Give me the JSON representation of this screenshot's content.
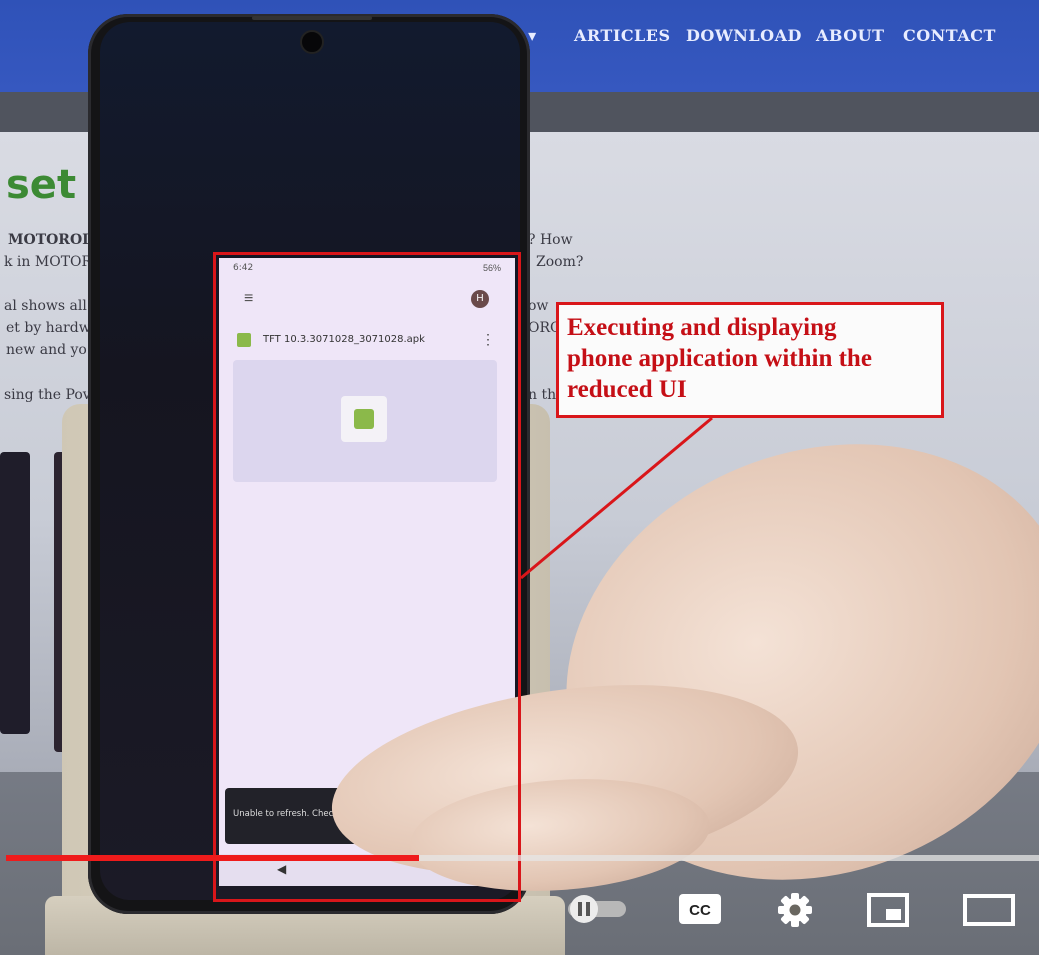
{
  "site": {
    "nav_items": [
      "S ▾",
      "ARTICLES",
      "DOWNLOAD",
      "ABOUT",
      "CONTACT"
    ],
    "heading": "set M",
    "lines": [
      {
        "text": "MOTOROLA",
        "bold": true
      },
      {
        "text": "k in MOTOR",
        "bold": false
      },
      {
        "text": "? How",
        "bold": false
      },
      {
        "text": "Zoom?",
        "bold": false
      },
      {
        "text": "al shows all",
        "bold": false
      },
      {
        "text": "et by hardw",
        "bold": false
      },
      {
        "text": "new and yo",
        "bold": false
      },
      {
        "text": "sing the Pov",
        "bold": false
      },
      {
        "text": "ow",
        "bold": false
      },
      {
        "text": "ORO",
        "bold": false
      },
      {
        "text": "n th",
        "bold": false
      }
    ]
  },
  "app": {
    "status_time": "6:42",
    "battery": "56%",
    "avatar_letter": "H",
    "file_name": "TFT 10.3.3071028_3071028.apk",
    "snackbar_text": "Unable to refresh. Check your netw... swipe down to retry."
  },
  "annotation": {
    "lines": [
      "Executing and displaying",
      "phone application within the",
      "reduced UI"
    ]
  },
  "player": {
    "progress": 0.4,
    "accent_color": "#ef1b1b",
    "controls": [
      "autoplay-toggle-icon",
      "cc-icon",
      "settings-gear-icon",
      "miniplayer-icon",
      "theater-mode-icon"
    ],
    "cc_label": "CC"
  }
}
